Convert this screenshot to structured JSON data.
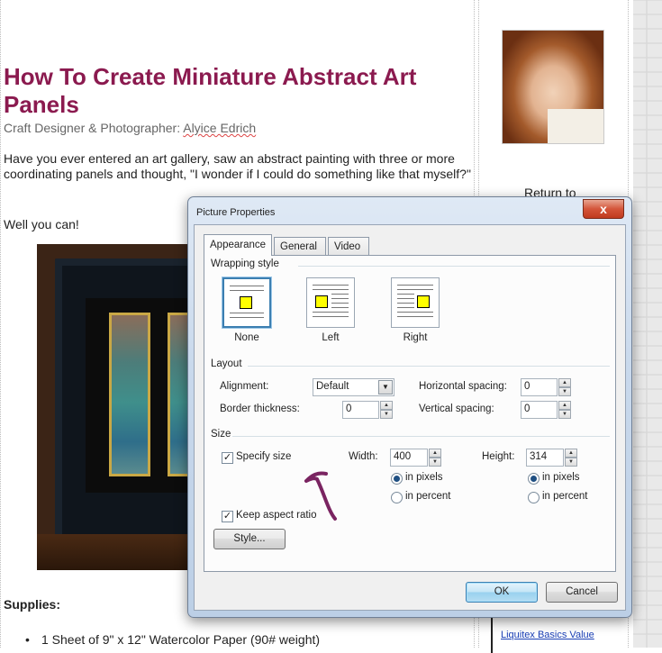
{
  "article": {
    "title": "How To Create Miniature Abstract Art Panels",
    "byline_prefix": "Craft Designer & Photographer: ",
    "byline_author": "Alyice Edrich",
    "intro": "Have you ever entered an art gallery, saw an abstract painting with three or more coordinating panels and thought, \"I wonder if I could do something like that myself?\"",
    "intro2": "Well you can!",
    "supplies_heading": "Supplies:",
    "supplies": [
      "1 Sheet of 9\" x 12\" Watercolor Paper (90# weight)"
    ]
  },
  "sidebar": {
    "return_to": "Return to",
    "link_text": "Liquitex Basics Value"
  },
  "dialog": {
    "title": "Picture Properties",
    "close_glyph": "x",
    "tabs": [
      {
        "label": "Appearance",
        "active": true
      },
      {
        "label": "General",
        "active": false
      },
      {
        "label": "Video",
        "active": false
      }
    ],
    "wrapping": {
      "label": "Wrapping style",
      "options": [
        {
          "label": "None",
          "selected": true
        },
        {
          "label": "Left",
          "selected": false
        },
        {
          "label": "Right",
          "selected": false
        }
      ]
    },
    "layout": {
      "label": "Layout",
      "alignment_label": "Alignment:",
      "alignment_value": "Default",
      "border_label": "Border thickness:",
      "border_value": "0",
      "hspacing_label": "Horizontal spacing:",
      "hspacing_value": "0",
      "vspacing_label": "Vertical spacing:",
      "vspacing_value": "0"
    },
    "size": {
      "label": "Size",
      "specify_size_label": "Specify size",
      "specify_size_checked": true,
      "width_label": "Width:",
      "width_value": "400",
      "height_label": "Height:",
      "height_value": "314",
      "in_pixels": "in pixels",
      "in_percent": "in percent",
      "keep_aspect_label": "Keep aspect ratio",
      "keep_aspect_checked": true
    },
    "style_button": "Style...",
    "ok_button": "OK",
    "cancel_button": "Cancel",
    "check_glyph": "✓"
  },
  "colors": {
    "title": "#8b1a4f",
    "wrap_square": "#ffff00",
    "scribble": "#7a2461"
  }
}
